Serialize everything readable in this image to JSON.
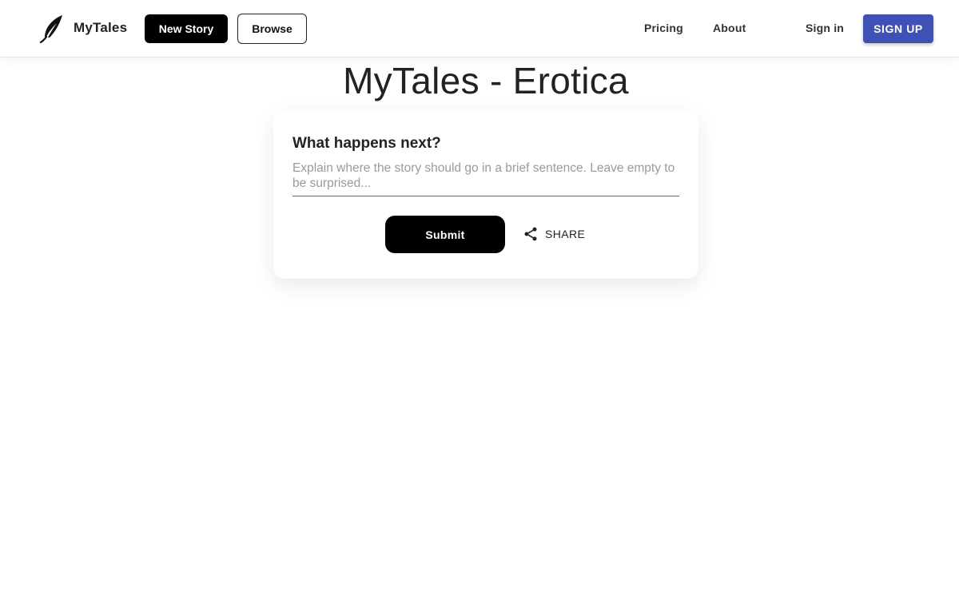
{
  "header": {
    "brand": "MyTales",
    "logo_icon": "quill-pen-icon",
    "new_story_label": "New Story",
    "browse_label": "Browse",
    "nav": {
      "pricing": "Pricing",
      "about": "About",
      "sign_in": "Sign in",
      "sign_up": "SIGN UP"
    },
    "colors": {
      "sign_up_bg": "#3f51b5",
      "primary_button_bg": "#000000"
    }
  },
  "main": {
    "title": "MyTales - Erotica",
    "card": {
      "heading": "What happens next?",
      "input": {
        "value": "",
        "placeholder": "Explain where the story should go in a brief sentence. Leave empty to be surprised..."
      },
      "submit_label": "Submit",
      "share_label": "SHARE",
      "share_icon": "share-icon"
    }
  }
}
